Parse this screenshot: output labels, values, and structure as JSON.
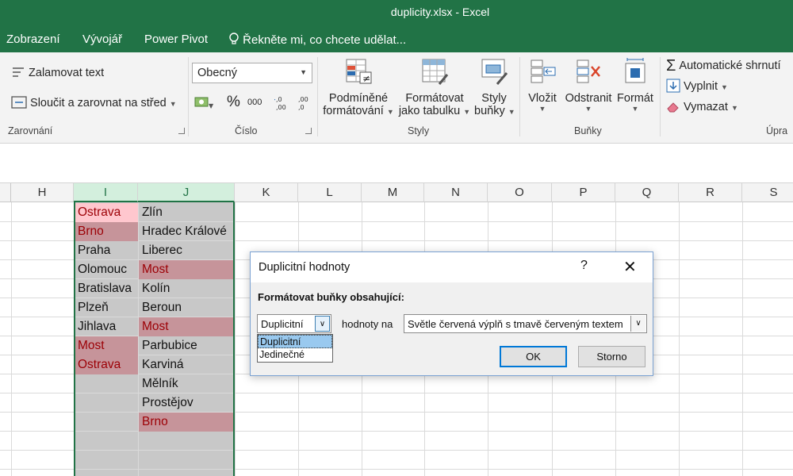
{
  "window": {
    "title": "duplicity.xlsx - Excel"
  },
  "menu": {
    "items": [
      "Zobrazení",
      "Vývojář",
      "Power Pivot"
    ],
    "tell_me": "Řekněte mi, co chcete udělat..."
  },
  "ribbon": {
    "wrap_text": "Zalamovat text",
    "merge_center": "Sloučit a zarovnat na střed",
    "group_alignment": "Zarovnání",
    "number_format": "Obecný",
    "percent": "%",
    "thousands": "000",
    "group_number": "Číslo",
    "cond_format_1": "Podmíněné",
    "cond_format_2": "formátování",
    "format_table_1": "Formátovat",
    "format_table_2": "jako tabulku",
    "cell_styles_1": "Styly",
    "cell_styles_2": "buňky",
    "group_styles": "Styly",
    "insert": "Vložit",
    "delete": "Odstranit",
    "format": "Formát",
    "group_cells": "Buňky",
    "autosum": "Automatické shrnutí",
    "fill": "Vyplnit",
    "clear": "Vymazat",
    "group_editing": "Úpra"
  },
  "columns": [
    "H",
    "I",
    "J",
    "K",
    "L",
    "M",
    "N",
    "O",
    "P",
    "Q",
    "R",
    "S"
  ],
  "colI": [
    {
      "text": "Ostrava",
      "dup": true,
      "active": true
    },
    {
      "text": "Brno",
      "dup": true
    },
    {
      "text": "Praha",
      "dup": false
    },
    {
      "text": "Olomouc",
      "dup": false
    },
    {
      "text": "Bratislava",
      "dup": false
    },
    {
      "text": "Plzeň",
      "dup": false
    },
    {
      "text": "Jihlava",
      "dup": false
    },
    {
      "text": "Most",
      "dup": true
    },
    {
      "text": "Ostrava",
      "dup": true
    }
  ],
  "colJ": [
    {
      "text": "Zlín",
      "dup": false
    },
    {
      "text": "Hradec Králové",
      "dup": false
    },
    {
      "text": "Liberec",
      "dup": false
    },
    {
      "text": "Most",
      "dup": true
    },
    {
      "text": "Kolín",
      "dup": false
    },
    {
      "text": "Beroun",
      "dup": false
    },
    {
      "text": "Most",
      "dup": true
    },
    {
      "text": "Parbubice",
      "dup": false
    },
    {
      "text": "Karviná",
      "dup": false
    },
    {
      "text": "Mělník",
      "dup": false
    },
    {
      "text": "Prostějov",
      "dup": false
    },
    {
      "text": "Brno",
      "dup": true
    }
  ],
  "dialog": {
    "title": "Duplicitní hodnoty",
    "help": "?",
    "close": "✕",
    "heading": "Formátovat buňky obsahující:",
    "type_value": "Duplicitní",
    "values_with": "hodnoty na",
    "format_value": "Světle červená výplň s tmavě červeným textem",
    "options": [
      "Duplicitní",
      "Jedinečné"
    ],
    "ok": "OK",
    "cancel": "Storno"
  },
  "colors": {
    "excel_green": "#217346",
    "dup_fill": "#ffc7ce",
    "dup_text": "#9c0006"
  }
}
